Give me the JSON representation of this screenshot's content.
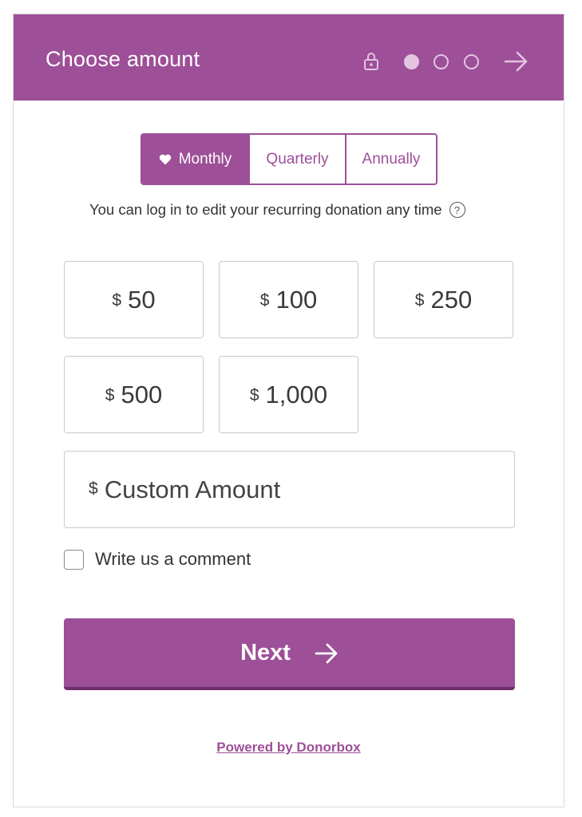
{
  "header": {
    "title": "Choose amount",
    "icons": [
      "lock-icon",
      "step-dot",
      "arrow-right-icon"
    ],
    "steps_total": 3,
    "current_step": 1
  },
  "frequency": {
    "tabs": [
      {
        "label": "Monthly",
        "selected": true,
        "icon": "heart-icon"
      },
      {
        "label": "Quarterly",
        "selected": false
      },
      {
        "label": "Annually",
        "selected": false
      }
    ]
  },
  "recurring_note": "You can log in to edit your recurring donation any time",
  "currency_symbol": "$",
  "amounts": [
    "50",
    "100",
    "250",
    "500",
    "1,000"
  ],
  "custom_amount": {
    "placeholder": "Custom Amount"
  },
  "comment": {
    "label": "Write us a comment",
    "checked": false
  },
  "next_button": {
    "label": "Next"
  },
  "footer": {
    "powered_by": "Powered by Donorbox"
  },
  "colors": {
    "brand": "#9d4f98",
    "brand_dark": "#6e2e69",
    "dot_light": "#e3c5e0"
  }
}
